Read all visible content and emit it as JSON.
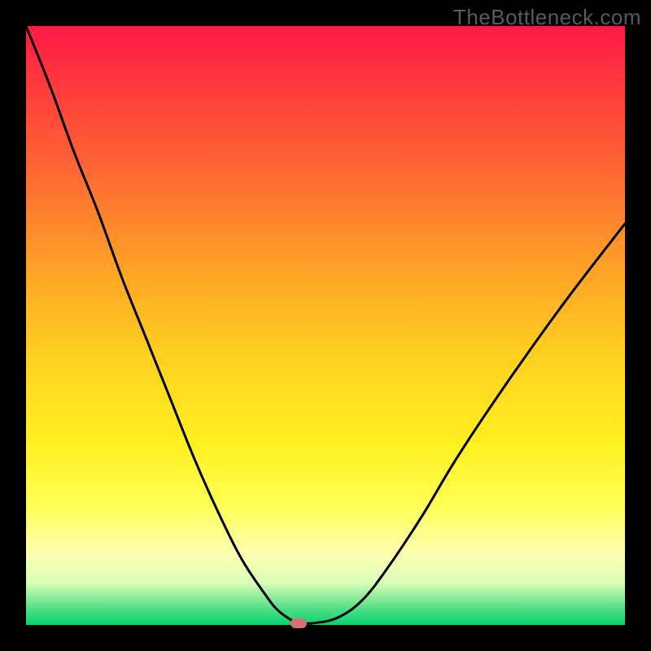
{
  "watermark": "TheBottleneck.com",
  "colors": {
    "black_frame": "#000000",
    "marker": "#d86f72",
    "gradient_top": "#ff1a45",
    "gradient_mid": "#ffe030",
    "gradient_bottom": "#06d26b"
  },
  "chart_data": {
    "type": "line",
    "title": "",
    "xlabel": "",
    "ylabel": "",
    "xlim": [
      0,
      100
    ],
    "ylim": [
      0,
      100
    ],
    "series": [
      {
        "name": "curve",
        "x": [
          0,
          4,
          8,
          12,
          16,
          20,
          24,
          28,
          32,
          36,
          40,
          42,
          44,
          45,
          46,
          48,
          52,
          56,
          60,
          66,
          72,
          80,
          90,
          100
        ],
        "y": [
          100,
          90,
          79,
          69,
          58,
          48,
          38,
          28,
          19,
          11,
          5,
          2.5,
          1,
          0.5,
          0.3,
          0.3,
          1.2,
          4,
          9,
          18,
          28,
          40,
          54,
          67
        ]
      }
    ],
    "marker": {
      "x": 45.5,
      "y": 0.3
    },
    "gradient_background": {
      "orientation": "vertical_top_to_bottom",
      "stops": [
        {
          "pos": 0.0,
          "color": "#ff1a45"
        },
        {
          "pos": 0.25,
          "color": "#ff6a32"
        },
        {
          "pos": 0.55,
          "color": "#ffd020"
        },
        {
          "pos": 0.8,
          "color": "#ffff55"
        },
        {
          "pos": 0.97,
          "color": "#5be08a"
        },
        {
          "pos": 1.0,
          "color": "#06d26b"
        }
      ]
    }
  }
}
